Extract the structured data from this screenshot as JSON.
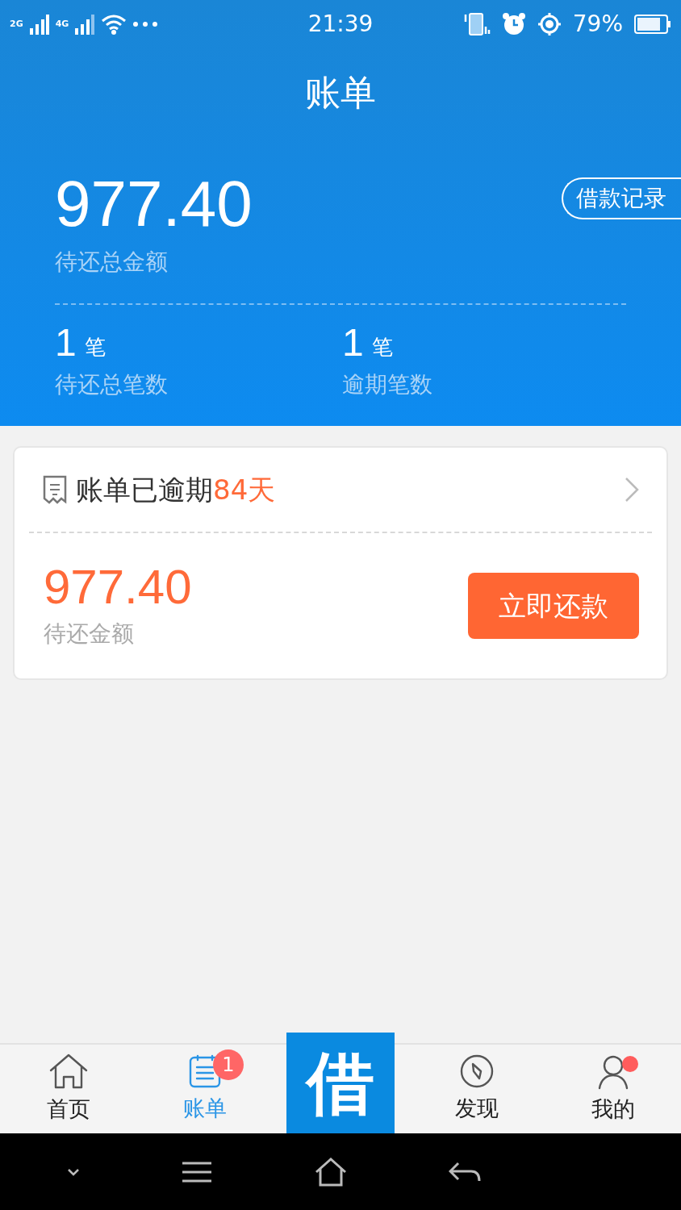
{
  "status_bar": {
    "network_1": "2G",
    "network_2": "4G",
    "time": "21:39",
    "battery": "79%"
  },
  "header": {
    "title": "账单"
  },
  "summary": {
    "total_amount": "977.40",
    "total_label": "待还总金额",
    "records_button": "借款记录",
    "stats": [
      {
        "count": "1",
        "unit": "笔",
        "label": "待还总笔数"
      },
      {
        "count": "1",
        "unit": "笔",
        "label": "逾期笔数"
      }
    ]
  },
  "bill_card": {
    "status_text": "账单已逾期",
    "overdue_days": "84天",
    "amount": "977.40",
    "amount_label": "待还金额",
    "pay_button": "立即还款"
  },
  "tab_bar": {
    "items": [
      {
        "label": "首页",
        "kind": "home",
        "selected": false,
        "dot": false
      },
      {
        "label": "账单",
        "kind": "bill",
        "selected": true,
        "badge": "1",
        "dot": false
      },
      {
        "label": "借",
        "kind": "center",
        "selected": false,
        "dot": false
      },
      {
        "label": "发现",
        "kind": "compass",
        "selected": false,
        "dot": false
      },
      {
        "label": "我的",
        "kind": "user",
        "selected": false,
        "dot": true
      }
    ]
  }
}
